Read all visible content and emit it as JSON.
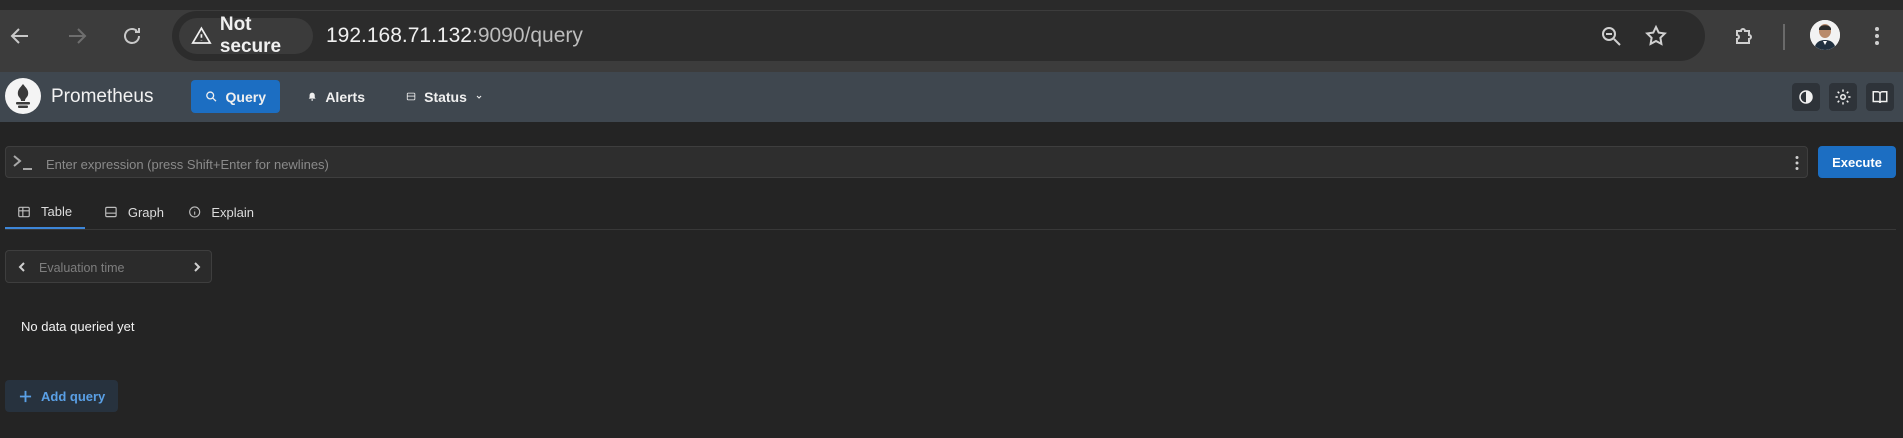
{
  "browser": {
    "security_label": "Not secure",
    "url_host": "192.168.71.132",
    "url_rest": ":9090/query"
  },
  "app": {
    "brand": "Prometheus",
    "nav": [
      {
        "label": "Query",
        "icon": "search-icon",
        "active": true
      },
      {
        "label": "Alerts",
        "icon": "bell-icon",
        "active": false
      },
      {
        "label": "Status",
        "icon": "server-icon",
        "active": false
      }
    ],
    "header_buttons": [
      "contrast-icon",
      "gear-icon",
      "book-icon"
    ]
  },
  "query": {
    "expression_placeholder": "Enter expression (press Shift+Enter for newlines)",
    "expression_value": "",
    "execute_label": "Execute",
    "tabs": [
      {
        "label": "Table",
        "icon": "table-icon",
        "active": true
      },
      {
        "label": "Graph",
        "icon": "graph-icon",
        "active": false
      },
      {
        "label": "Explain",
        "icon": "info-icon",
        "active": false
      }
    ],
    "evaluation_placeholder": "Evaluation time",
    "empty_message": "No data queried yet",
    "add_query_label": "Add query"
  },
  "colors": {
    "accent": "#1c6ec2",
    "header_bg": "#3f474f",
    "page_bg": "#242424"
  }
}
